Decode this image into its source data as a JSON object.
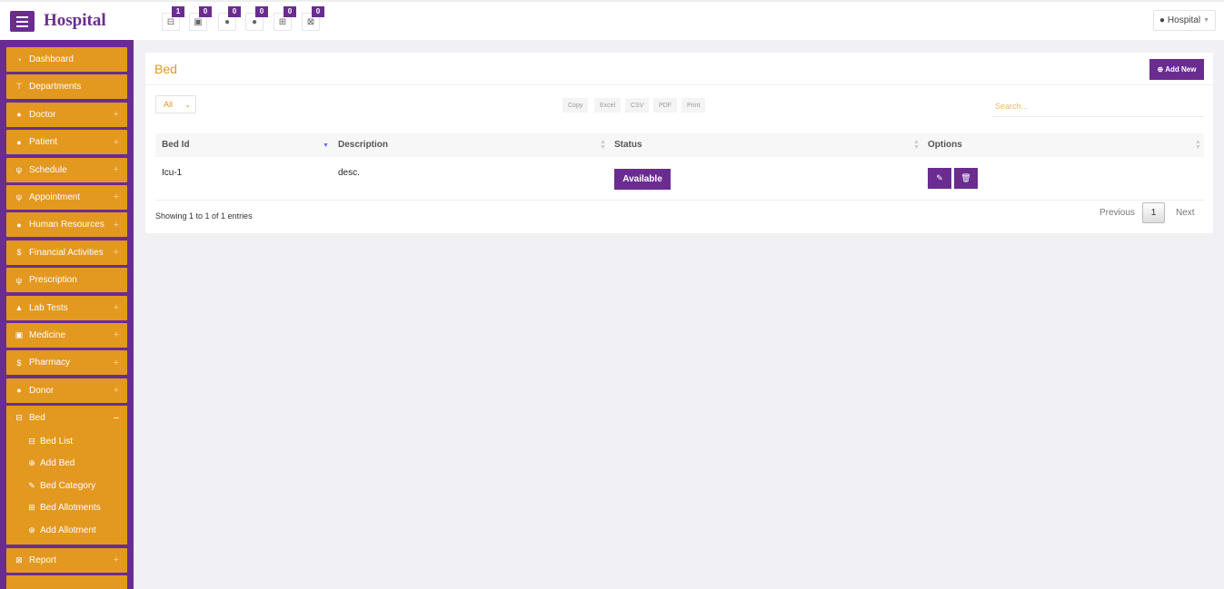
{
  "header": {
    "brand": "Hospital",
    "quick_links": [
      {
        "icon": "bed-icon",
        "glyph": "⊟",
        "count": "1"
      },
      {
        "icon": "money-icon",
        "glyph": "▣",
        "count": "0"
      },
      {
        "icon": "user-icon",
        "glyph": "●",
        "count": "0"
      },
      {
        "icon": "user-md-icon",
        "glyph": "●",
        "count": "0"
      },
      {
        "icon": "medkit-icon",
        "glyph": "⊞",
        "count": "0"
      },
      {
        "icon": "hospital-icon",
        "glyph": "⊠",
        "count": "0"
      }
    ],
    "user_label": "Hospital"
  },
  "sidebar": {
    "items": [
      {
        "label": "Dashboard",
        "icon": "dashboard-icon",
        "glyph": "◔",
        "expandable": false
      },
      {
        "label": "Departments",
        "icon": "sitemap-icon",
        "glyph": "⊤",
        "expandable": false
      },
      {
        "label": "Doctor",
        "icon": "users-icon",
        "glyph": "●",
        "expandable": true
      },
      {
        "label": "Patient",
        "icon": "users-icon",
        "glyph": "●",
        "expandable": true
      },
      {
        "label": "Schedule",
        "icon": "stethoscope-icon",
        "glyph": "ψ",
        "expandable": true
      },
      {
        "label": "Appointment",
        "icon": "stethoscope-icon",
        "glyph": "ψ",
        "expandable": true
      },
      {
        "label": "Human Resources",
        "icon": "users-icon",
        "glyph": "●",
        "expandable": true
      },
      {
        "label": "Financial Activities",
        "icon": "dollar-icon",
        "glyph": "$",
        "expandable": true
      },
      {
        "label": "Prescription",
        "icon": "stethoscope-icon",
        "glyph": "ψ",
        "expandable": false
      },
      {
        "label": "Lab Tests",
        "icon": "flask-icon",
        "glyph": "▲",
        "expandable": true
      },
      {
        "label": "Medicine",
        "icon": "medkit-icon",
        "glyph": "▣",
        "expandable": true
      },
      {
        "label": "Pharmacy",
        "icon": "dollar-icon",
        "glyph": "$",
        "expandable": true
      },
      {
        "label": "Donor",
        "icon": "user-icon",
        "glyph": "●",
        "expandable": true
      }
    ],
    "bed": {
      "label": "Bed",
      "glyph": "⊟",
      "subitems": [
        {
          "label": "Bed List",
          "icon": "bed-icon",
          "glyph": "⊟"
        },
        {
          "label": "Add Bed",
          "icon": "plus-circle-icon",
          "glyph": "⊕"
        },
        {
          "label": "Bed Category",
          "icon": "edit-icon",
          "glyph": "✎"
        },
        {
          "label": "Bed Allotments",
          "icon": "plus-square-icon",
          "glyph": "⊞"
        },
        {
          "label": "Add Allotment",
          "icon": "plus-circle-icon",
          "glyph": "⊕"
        }
      ]
    },
    "report": {
      "label": "Report",
      "icon": "hospital-icon",
      "glyph": "⊠"
    },
    "expand_glyph": "+",
    "collapse_glyph": "−"
  },
  "panel": {
    "title": "Bed",
    "add_new_label": "Add New",
    "add_new_glyph": "⊕",
    "length_value": "All",
    "export_buttons": [
      "Copy",
      "Excel",
      "CSV",
      "PDF",
      "Print"
    ],
    "search_placeholder": "Search...",
    "columns": [
      "Bed Id",
      "Description",
      "Status",
      "Options"
    ],
    "rows": [
      {
        "bed_id": "Icu-1",
        "description": "desc.",
        "status": "Available"
      }
    ],
    "info": "Showing 1 to 1 of 1 entries",
    "pagination": {
      "previous": "Previous",
      "page": "1",
      "next": "Next"
    }
  },
  "colors": {
    "purple": "#6b2c91",
    "orange": "#e39820"
  }
}
